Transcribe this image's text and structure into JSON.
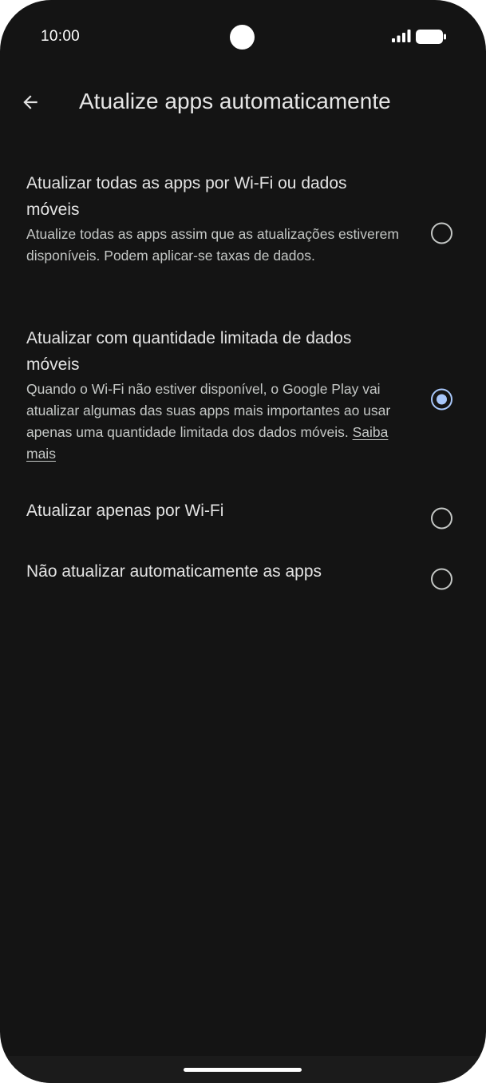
{
  "status_bar": {
    "time": "10:00"
  },
  "header": {
    "title": "Atualize apps automaticamente",
    "back_icon": "arrow-back-icon"
  },
  "options": [
    {
      "title": "Atualizar todas as apps por Wi-Fi ou dados móveis",
      "description": "Atualize todas as apps assim que as atualizações estiverem disponíveis. Podem aplicar-se taxas de dados.",
      "selected": false
    },
    {
      "title": "Atualizar com quantidade limitada de dados móveis",
      "description": "Quando o Wi-Fi não estiver disponível, o Google Play vai atualizar algumas das suas apps mais importantes ao usar apenas uma quantidade limitada dos dados móveis.",
      "link": "Saiba mais",
      "selected": true
    },
    {
      "title": "Atualizar apenas por Wi-Fi",
      "selected": false
    },
    {
      "title": "Não atualizar automaticamente as apps",
      "selected": false
    }
  ],
  "colors": {
    "background": "#141414",
    "accent": "#a8c7fa",
    "text_primary": "#e3e3e3",
    "text_secondary": "#c4c7c5"
  }
}
